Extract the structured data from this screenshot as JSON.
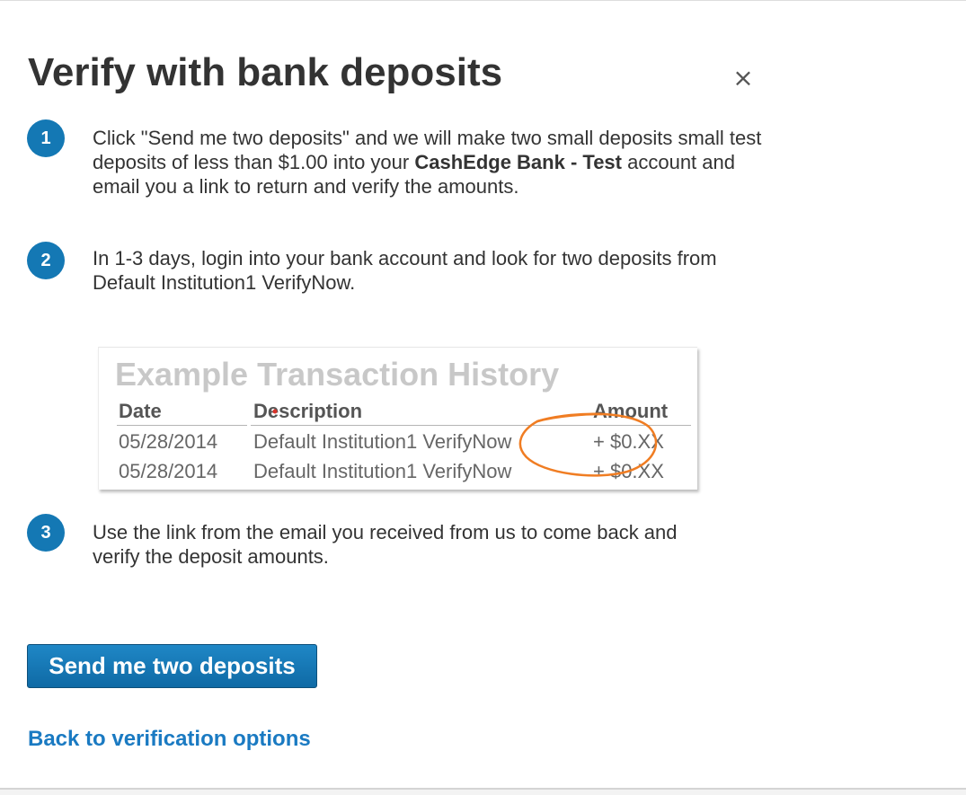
{
  "dialog": {
    "title": "Verify with bank deposits",
    "close_label": "×"
  },
  "steps": [
    {
      "number": "1",
      "text_before": "Click \"Send me two deposits\" and we will make two small deposits small test deposits of less than $1.00 into your ",
      "bank_name": "CashEdge Bank - Test",
      "text_after": " account and email you a link to return and verify the amounts."
    },
    {
      "number": "2",
      "text": "In 1-3 days, login into your bank account and look for two deposits from Default Institution1 VerifyNow."
    },
    {
      "number": "3",
      "text": "Use the link from the email you received from us to come back and verify the deposit amounts."
    }
  ],
  "example": {
    "title": "Example Transaction History",
    "headers": {
      "date": "Date",
      "description": "Description",
      "amount": "Amount"
    },
    "rows": [
      {
        "date": "05/28/2014",
        "description": "Default Institution1 VerifyNow",
        "amount": "+ $0.XX"
      },
      {
        "date": "05/28/2014",
        "description": "Default Institution1 VerifyNow",
        "amount": "+ $0.XX"
      }
    ],
    "highlight_color": "#f07d23"
  },
  "actions": {
    "send_button": "Send me two deposits",
    "back_link": "Back to verification options"
  },
  "colors": {
    "accent": "#1478b4",
    "link": "#1a7ac2",
    "text": "#333333"
  }
}
